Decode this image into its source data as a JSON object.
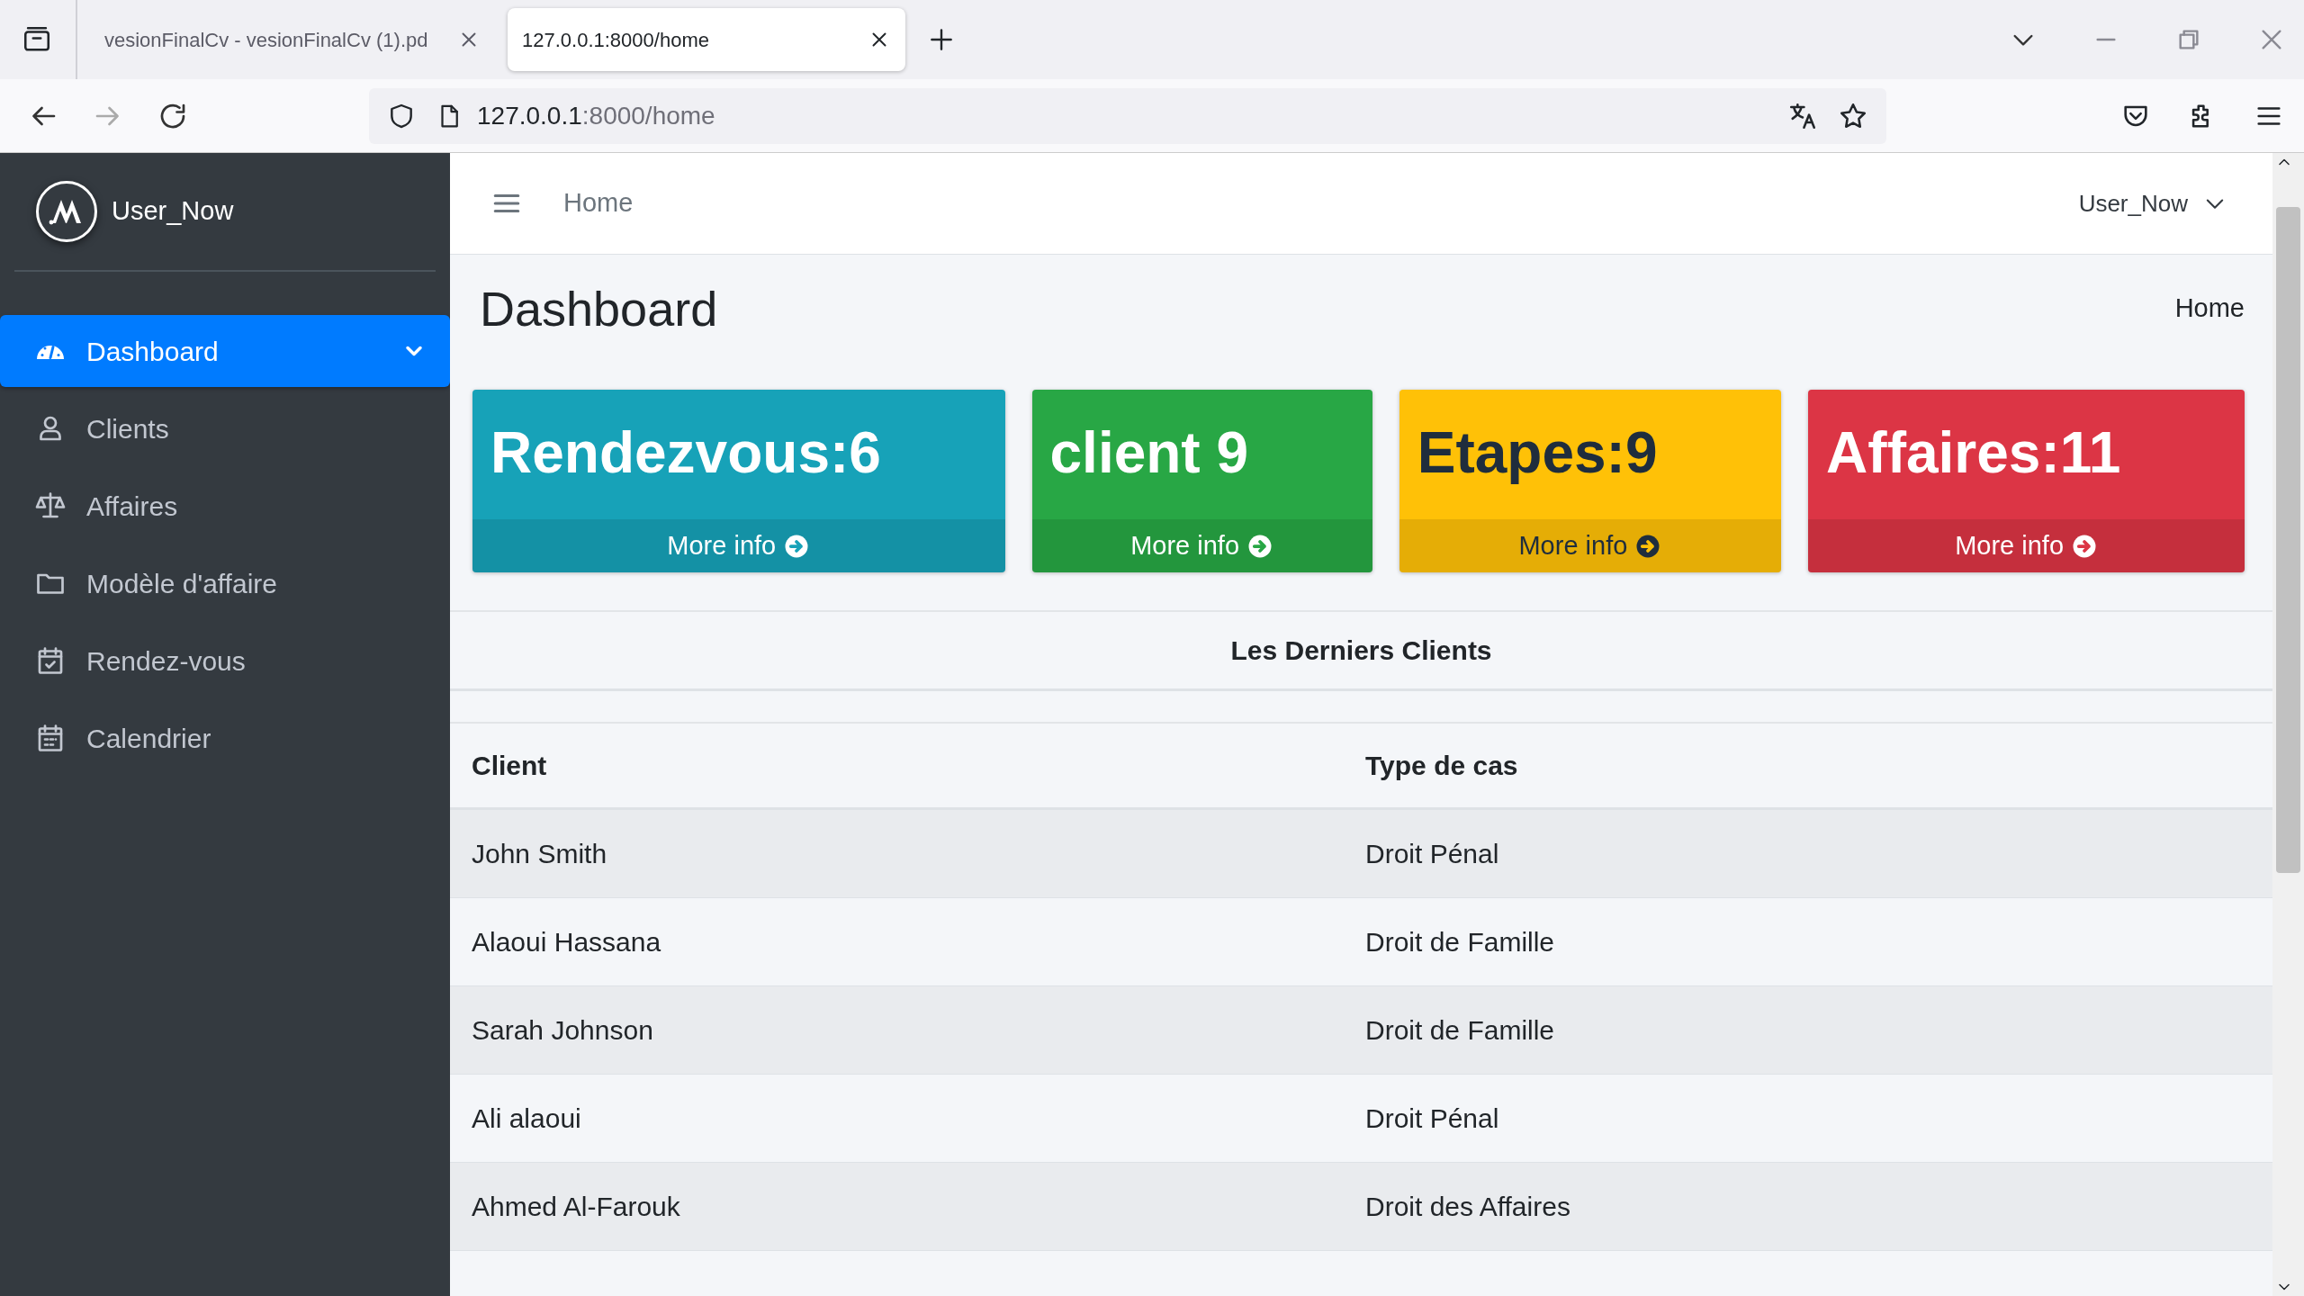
{
  "browser": {
    "tabs": [
      {
        "title": "vesionFinalCv - vesionFinalCv (1).pd",
        "selected": false
      },
      {
        "title": "127.0.0.1:8000/home",
        "selected": true
      }
    ],
    "address": {
      "host": "127.0.0.1",
      "path": ":8000/home"
    }
  },
  "sidebar": {
    "user": "User_Now",
    "items": [
      {
        "label": "Dashboard",
        "selected": true,
        "has_submenu": true
      },
      {
        "label": "Clients",
        "selected": false,
        "has_submenu": false
      },
      {
        "label": "Affaires",
        "selected": false,
        "has_submenu": false
      },
      {
        "label": "Modèle d'affaire",
        "selected": false,
        "has_submenu": false
      },
      {
        "label": "Rendez-vous",
        "selected": false,
        "has_submenu": false
      },
      {
        "label": "Calendrier",
        "selected": false,
        "has_submenu": false
      }
    ]
  },
  "navbar": {
    "link": "Home",
    "user": "User_Now"
  },
  "page": {
    "title": "Dashboard",
    "breadcrumb": "Home"
  },
  "stat_boxes": [
    {
      "value": "Rendezvous:6",
      "link": "More info",
      "color": "#17a2b8"
    },
    {
      "value": "client 9",
      "link": "More info",
      "color": "#28a745"
    },
    {
      "value": "Etapes:9",
      "link": "More info",
      "color": "#ffc107"
    },
    {
      "value": "Affaires:11",
      "link": "More info",
      "color": "#dc3545"
    }
  ],
  "table": {
    "title": "Les Derniers Clients",
    "columns": [
      "Client",
      "Type de cas"
    ],
    "rows": [
      [
        "John Smith",
        "Droit Pénal"
      ],
      [
        "Alaoui Hassana",
        "Droit de Famille"
      ],
      [
        "Sarah Johnson",
        "Droit de Famille"
      ],
      [
        "Ali alaoui",
        "Droit Pénal"
      ],
      [
        "Ahmed Al-Farouk",
        "Droit des Affaires"
      ]
    ]
  }
}
